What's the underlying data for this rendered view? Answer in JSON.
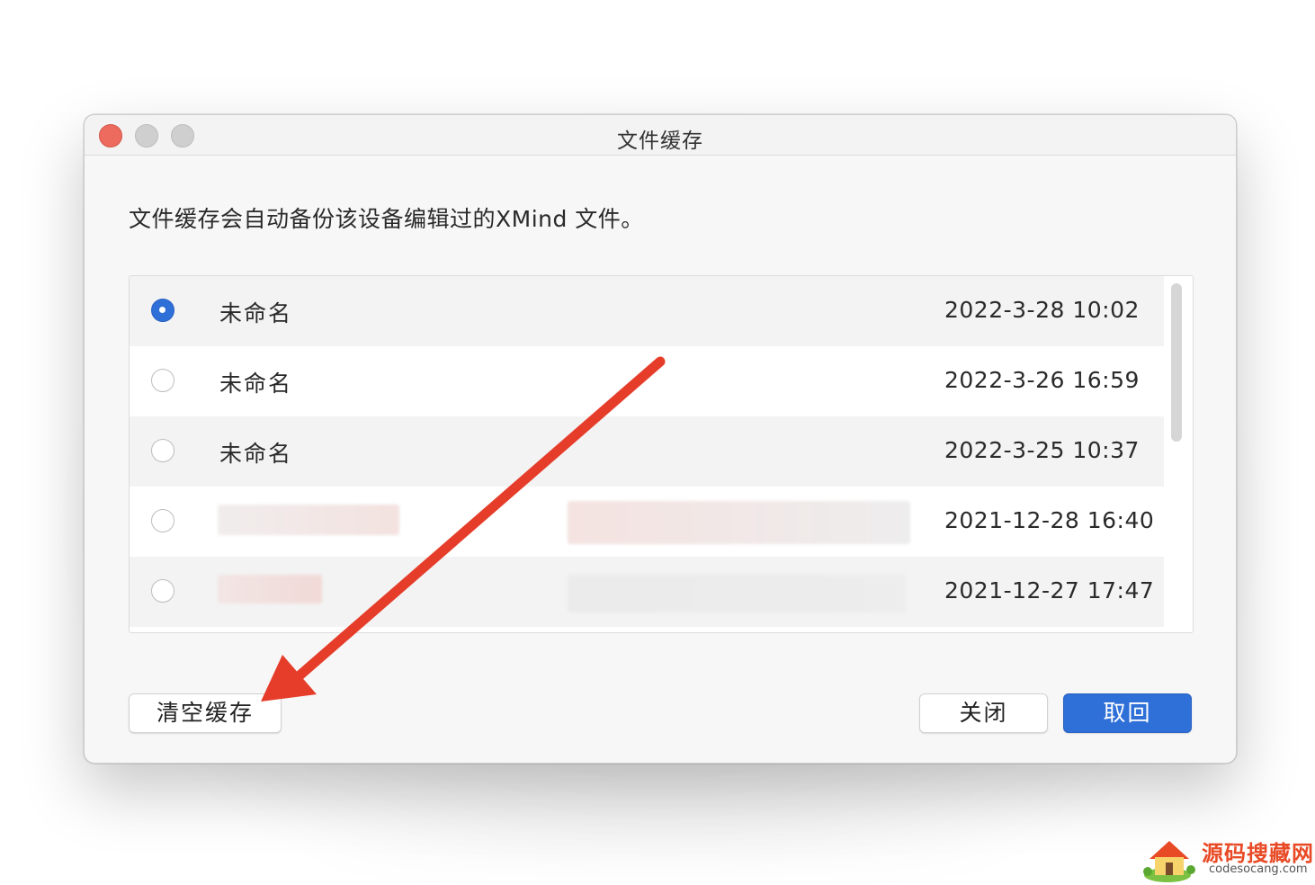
{
  "window": {
    "title": "文件缓存",
    "description": "文件缓存会自动备份该设备编辑过的XMind 文件。"
  },
  "files": [
    {
      "name": "未命名",
      "date": "2022-3-28 10:02",
      "selected": true
    },
    {
      "name": "未命名",
      "date": "2022-3-26 16:59",
      "selected": false
    },
    {
      "name": "未命名",
      "date": "2022-3-25 10:37",
      "selected": false
    },
    {
      "name": "",
      "date": "2021-12-28 16:40",
      "selected": false
    },
    {
      "name": "",
      "date": "2021-12-27 17:47",
      "selected": false
    }
  ],
  "buttons": {
    "clear": "清空缓存",
    "close": "关闭",
    "restore": "取回"
  },
  "colors": {
    "accent": "#2f6fd8",
    "arrow": "#e53d2a",
    "close_light": "#ed6a5e"
  },
  "watermark": {
    "title": "源码搜藏网",
    "url": "codesocang.com"
  }
}
